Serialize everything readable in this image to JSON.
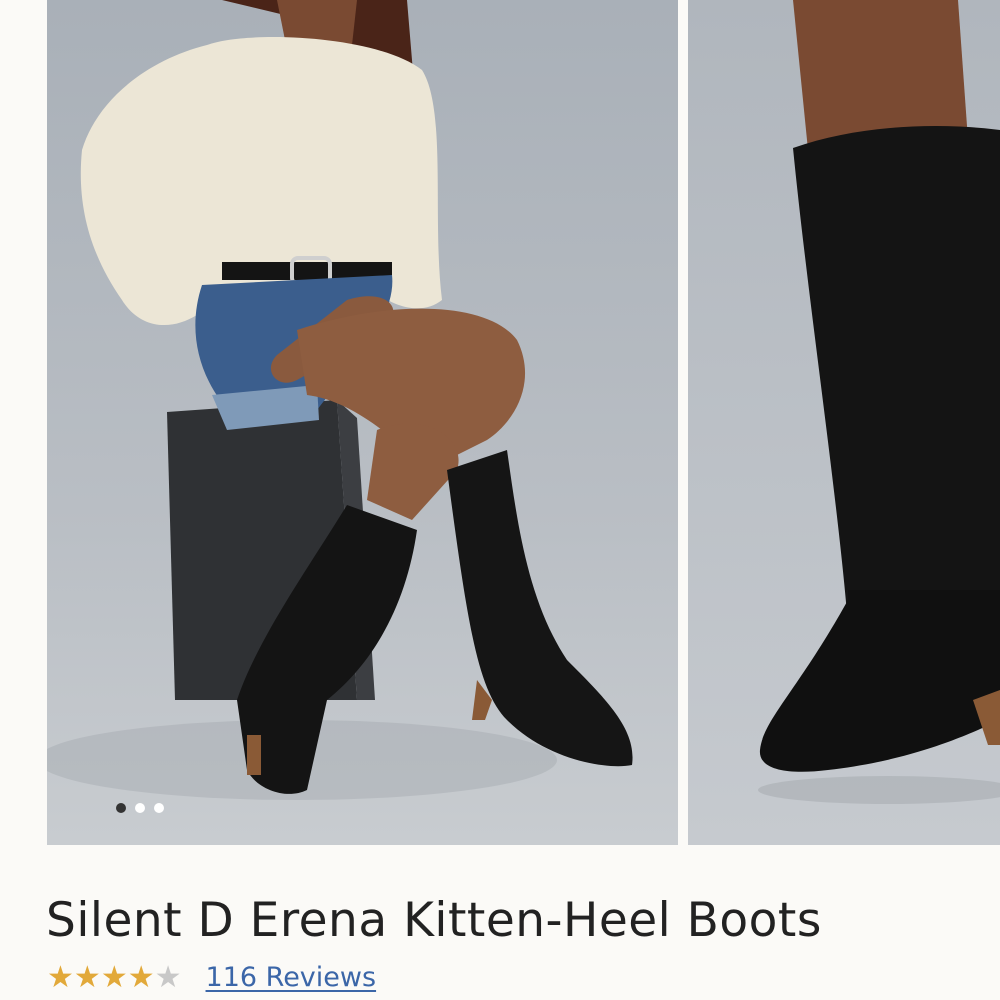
{
  "product": {
    "title": "Silent D Erena Kitten-Heel Boots",
    "rating": 4,
    "rating_max": 5,
    "reviews_label": "116 Reviews"
  },
  "gallery": {
    "image_count": 3,
    "active_index": 0
  },
  "colors": {
    "link": "#3b66a8",
    "star_filled": "#e2a93a",
    "star_empty": "#c8c8c8"
  }
}
